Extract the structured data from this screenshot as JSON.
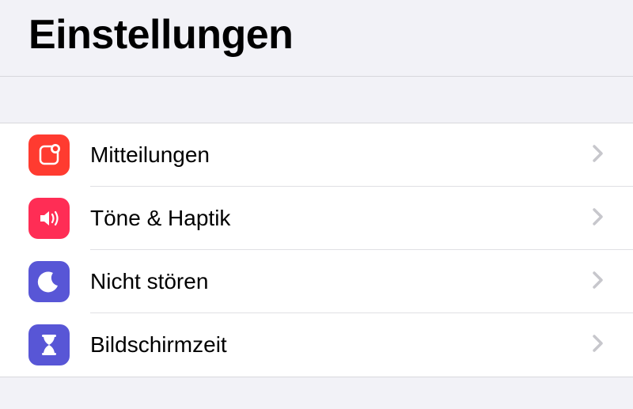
{
  "header": {
    "title": "Einstellungen"
  },
  "rows": [
    {
      "label": "Mitteilungen",
      "icon": "notifications-icon",
      "color": "red"
    },
    {
      "label": "Töne & Haptik",
      "icon": "sounds-icon",
      "color": "pink"
    },
    {
      "label": "Nicht stören",
      "icon": "do-not-disturb-icon",
      "color": "purple"
    },
    {
      "label": "Bildschirmzeit",
      "icon": "screen-time-icon",
      "color": "purple"
    }
  ]
}
